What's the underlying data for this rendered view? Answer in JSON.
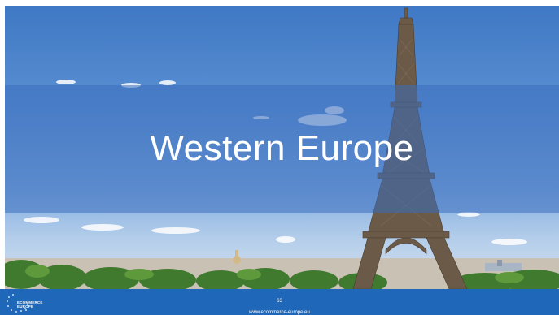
{
  "slide": {
    "title": "Western Europe",
    "page_number": "63",
    "website": "www.ecommerce-europe.eu"
  },
  "logo": {
    "line1": "ECOMMERCE",
    "line2": "EUROPE"
  },
  "colors": {
    "footer": "#1f67b8",
    "band": "#3a6ebe",
    "sky_top": "#3f78c4",
    "text": "#ffffff"
  },
  "icons": [
    "eiffel-tower-image",
    "star-icon"
  ]
}
